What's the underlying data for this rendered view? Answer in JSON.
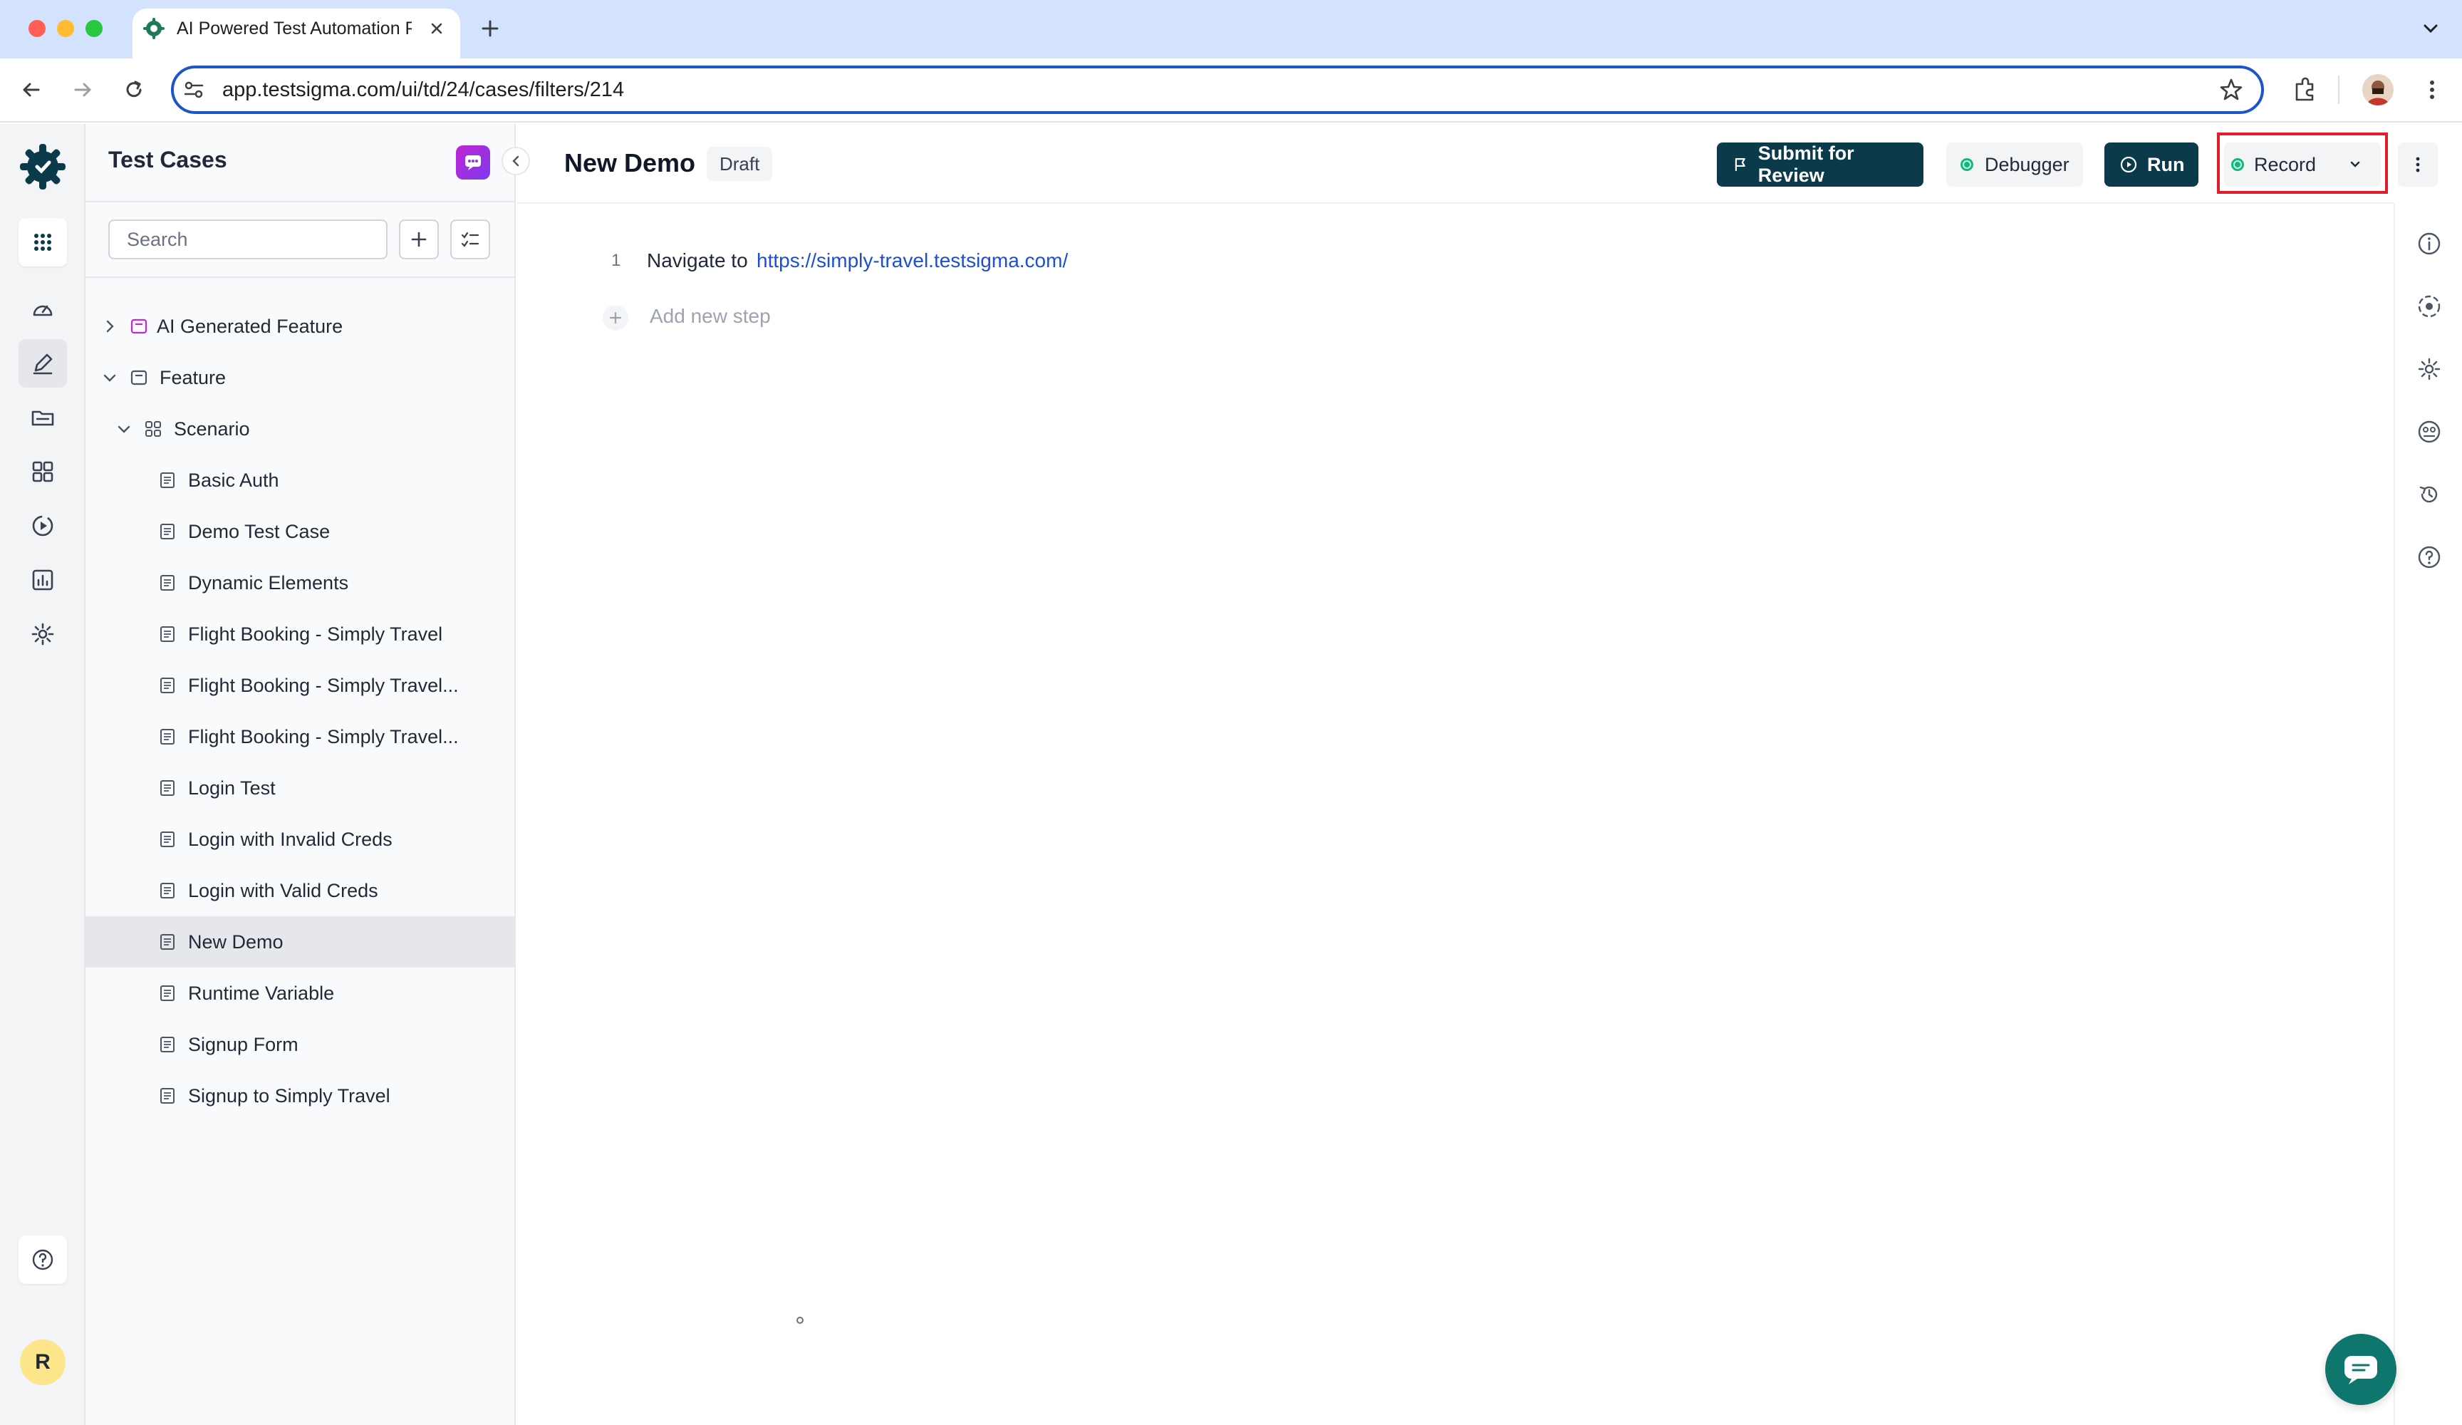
{
  "browser": {
    "tab_title": "AI Powered Test Automation P",
    "url": "app.testsigma.com/ui/td/24/cases/filters/214",
    "traffic_colors": [
      "#ff5f57",
      "#febc2e",
      "#28c840"
    ]
  },
  "rail": {
    "items": [
      "grid-icon",
      "dashboard-icon",
      "edit-icon",
      "folder-icon",
      "modules-icon",
      "run-icon",
      "reports-icon",
      "settings-icon"
    ],
    "avatar_initial": "R"
  },
  "panel": {
    "title": "Test Cases",
    "search_placeholder": "Search",
    "tree": {
      "ai_feature": "AI Generated Feature",
      "feature": "Feature",
      "scenario": "Scenario",
      "cases": [
        "Basic Auth",
        "Demo Test Case",
        "Dynamic Elements",
        "Flight Booking - Simply Travel",
        "Flight Booking - Simply Travel...",
        "Flight Booking - Simply Travel...",
        "Login Test",
        "Login with Invalid Creds",
        "Login with Valid Creds",
        "New Demo",
        "Runtime Variable",
        "Signup Form",
        "Signup to Simply Travel"
      ],
      "selected": "New Demo"
    }
  },
  "editor": {
    "title": "New Demo",
    "status_badge": "Draft",
    "submit_label": "Submit for Review",
    "debugger_label": "Debugger",
    "run_label": "Run",
    "record_label": "Record",
    "steps": [
      {
        "number": "1",
        "action": "Navigate to",
        "target": "https://simply-travel.testsigma.com/"
      }
    ],
    "add_step_label": "Add new step"
  },
  "colors": {
    "primary_dark": "#0b3b4a",
    "highlight_border": "#e11d2a",
    "link": "#1d4ed8",
    "status_green": "#10b981"
  }
}
